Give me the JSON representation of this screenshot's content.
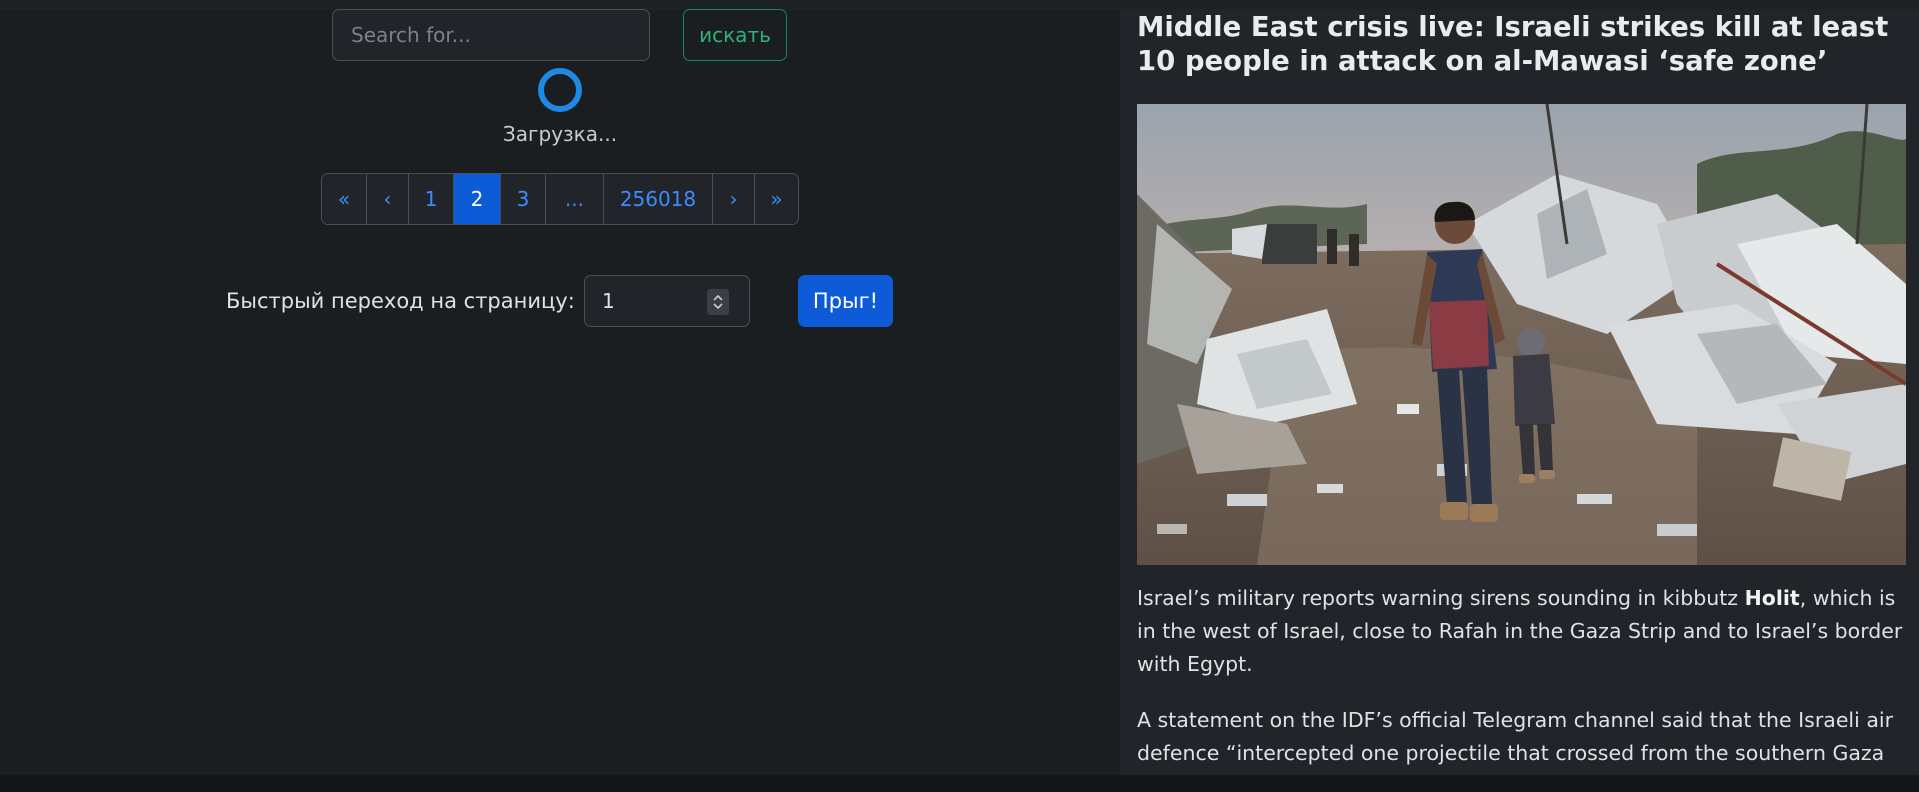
{
  "search": {
    "placeholder": "Search for...",
    "button_label": "искать"
  },
  "loading": {
    "text": "Загрузка..."
  },
  "pagination": {
    "first": "«",
    "prev": "‹",
    "pages": [
      "1",
      "2",
      "3",
      "...",
      "256018"
    ],
    "active_page": "2",
    "next": "›",
    "last": "»"
  },
  "goto": {
    "label": "Быстрый переход на страницу:",
    "value": "1",
    "button_label": "Прыг!"
  },
  "article": {
    "title": "Middle East crisis live: Israeli strikes kill at least 10 people in attack on al-Mawasi ‘safe zone’",
    "paragraph1_before": "Israel’s military reports warning sirens sounding in kibbutz ",
    "paragraph1_bold": "Holit",
    "paragraph1_after": ", which is in the west of Israel, close to Rafah in the Gaza Strip and to Israel’s border with Egypt.",
    "paragraph2": "A statement on the IDF’s official Telegram channel said that the Israeli air defence “intercepted one projectile that crossed from the southern Gaza"
  },
  "colors": {
    "background": "#1b1e21",
    "panel": "#212529",
    "accent_blue": "#0d5bd7",
    "link_blue": "#3d8bfd",
    "success_green": "#198754"
  }
}
